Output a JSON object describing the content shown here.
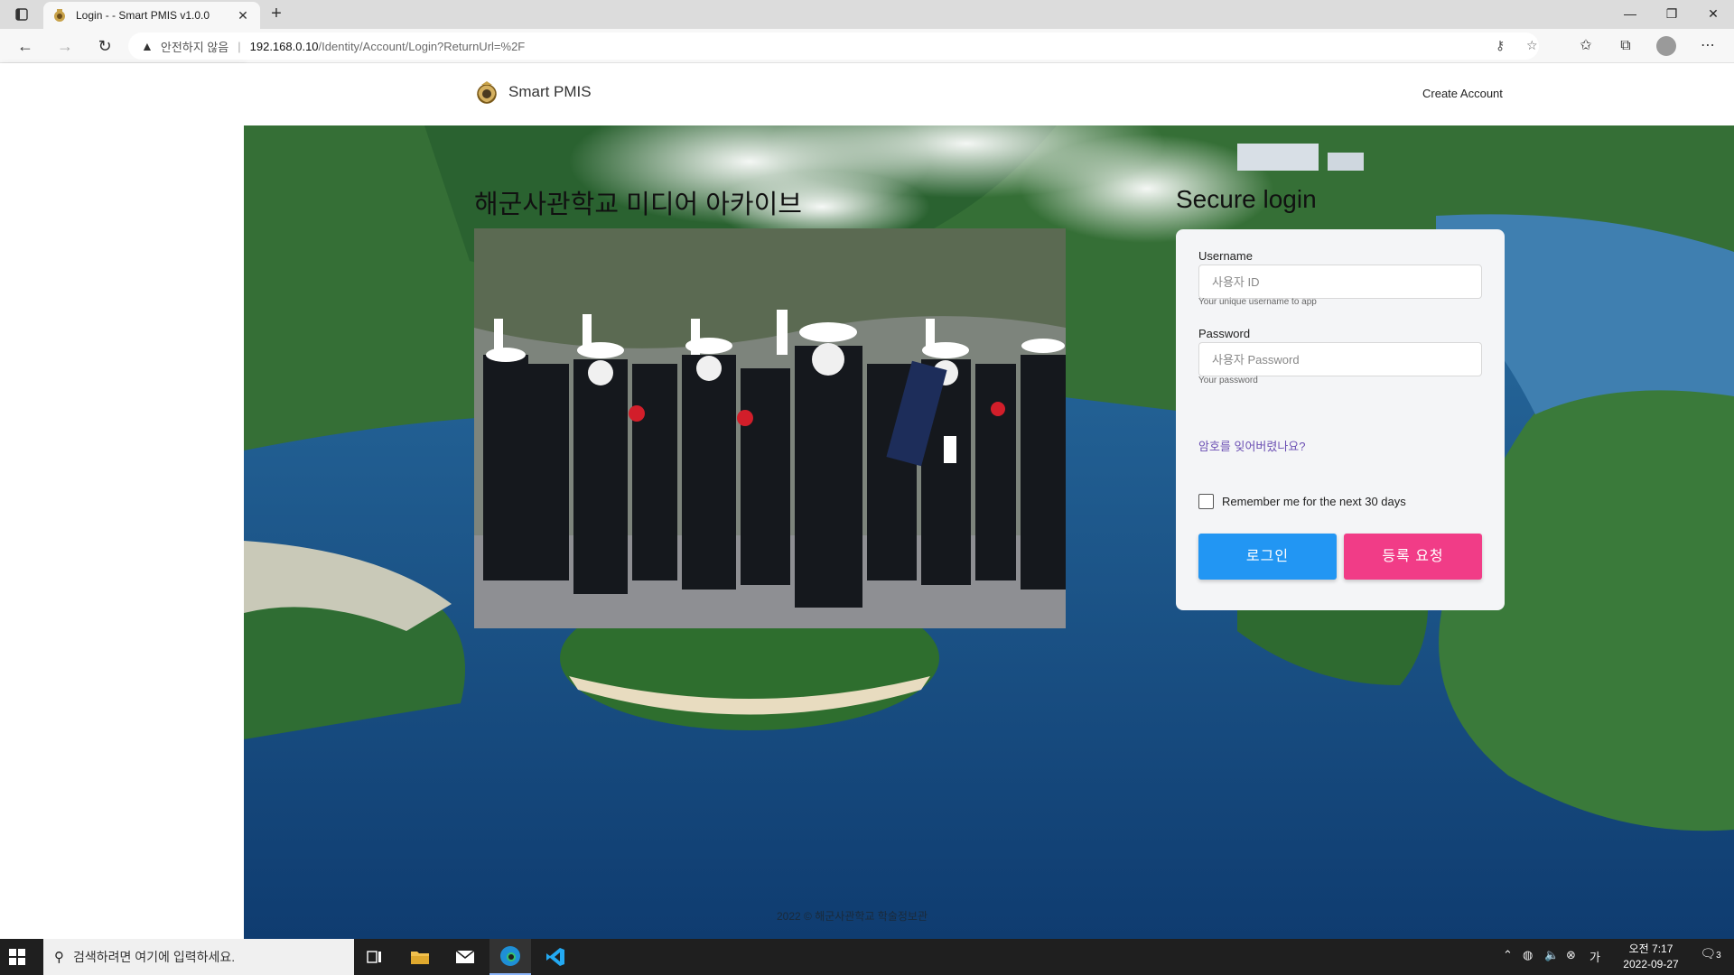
{
  "browser": {
    "tab_title": "Login - - Smart PMIS v1.0.0",
    "tab_close": "✕",
    "new_tab": "+",
    "insecure_label": "안전하지 않음",
    "url_host": "192.168.0.10",
    "url_path": "/Identity/Account/Login?ReturnUrl=%2F"
  },
  "header": {
    "brand": "Smart PMIS",
    "create_account": "Create Account"
  },
  "main": {
    "heading": "해군사관학교 미디어 아카이브"
  },
  "login": {
    "title": "Secure login",
    "username_label": "Username",
    "username_placeholder": "사용자 ID",
    "username_hint": "Your unique username to app",
    "password_label": "Password",
    "password_placeholder": "사용자 Password",
    "password_hint": "Your password",
    "forgot": "암호를 잊어버렸나요?",
    "remember": "Remember me for the next 30 days",
    "login_button": "로그인",
    "register_button": "등록 요청",
    "login_color": "#2296f3",
    "register_color": "#f13c87"
  },
  "footer": {
    "text": "2022 © 해군사관학교 학술정보관"
  },
  "taskbar": {
    "search_placeholder": "검색하려면 여기에 입력하세요.",
    "time": "오전 7:17",
    "date": "2022-09-27",
    "notification_count": "3"
  }
}
